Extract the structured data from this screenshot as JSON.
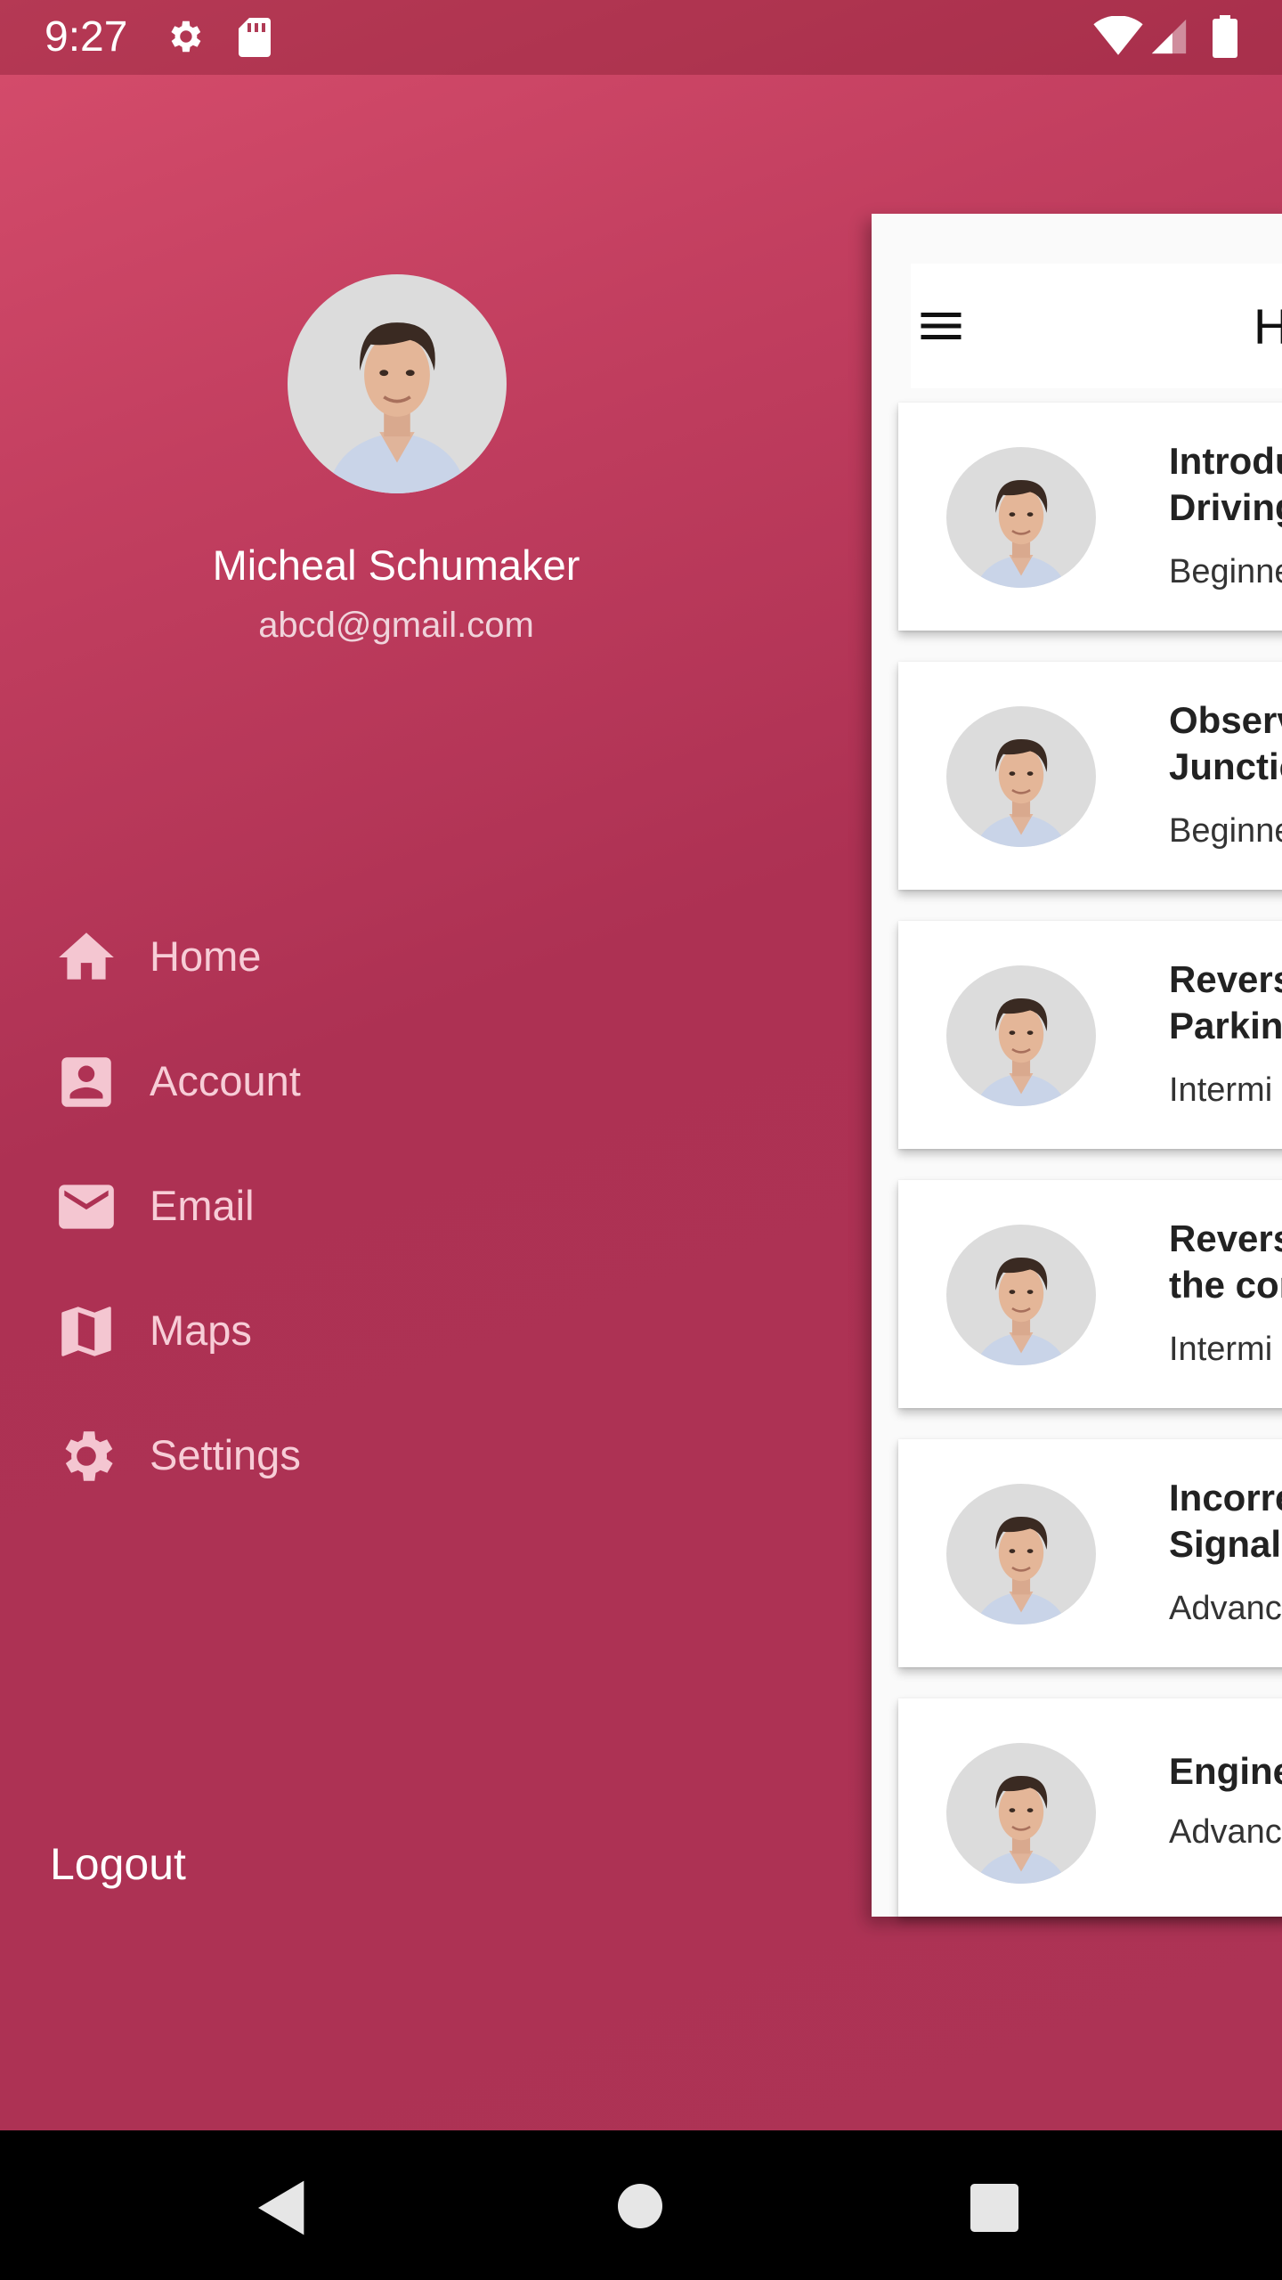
{
  "status_bar": {
    "time": "9:27",
    "icons": [
      "gear-icon",
      "sd-card-icon",
      "wifi-icon",
      "signal-icon",
      "battery-icon"
    ]
  },
  "drawer": {
    "user_name": "Micheal Schumaker",
    "user_email": "abcd@gmail.com",
    "items": [
      {
        "label": "Home",
        "icon": "home-icon"
      },
      {
        "label": "Account",
        "icon": "account-box-icon"
      },
      {
        "label": "Email",
        "icon": "email-icon"
      },
      {
        "label": "Maps",
        "icon": "map-icon"
      },
      {
        "label": "Settings",
        "icon": "settings-icon"
      }
    ],
    "logout_label": "Logout"
  },
  "home": {
    "title": "Ho",
    "lessons": [
      {
        "title": "Introdu\nDriving",
        "level": "Beginne"
      },
      {
        "title": "Observ\nJunctio",
        "level": "Beginne"
      },
      {
        "title": "Revers\nParkin",
        "level": "Intermi"
      },
      {
        "title": "Revers\nthe cor",
        "level": "Intermi"
      },
      {
        "title": "Incorre\nSignal",
        "level": "Advanc"
      },
      {
        "title": "Engine",
        "level": "Advanc"
      }
    ]
  },
  "colors": {
    "drawer_gradient_top": "#d64d6c",
    "drawer_gradient_bottom": "#ad3355",
    "menu_text": "#f7cdd7"
  }
}
